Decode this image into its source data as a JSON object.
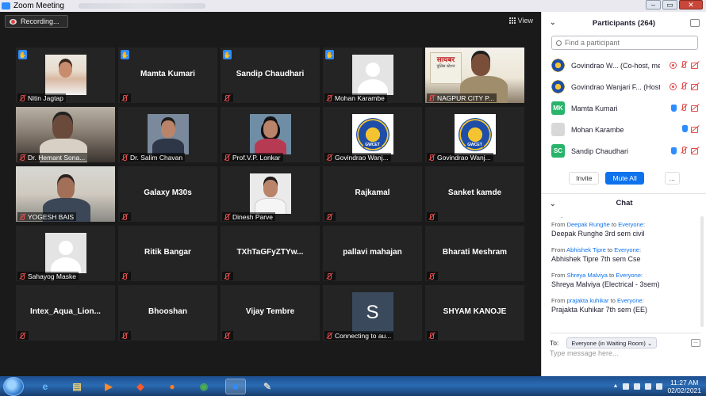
{
  "window": {
    "title": "Zoom Meeting"
  },
  "toolbar": {
    "recording_label": "Recording...",
    "view_label": "View"
  },
  "tiles": [
    {
      "name": "Nitin Jagtap",
      "kind": "child-photo",
      "hand": true
    },
    {
      "name": "Mamta Kumari",
      "kind": "name",
      "hand": true
    },
    {
      "name": "Sandip Chaudhari",
      "kind": "name",
      "hand": true
    },
    {
      "name": "Mohan Karambe",
      "kind": "avatar",
      "hand": true
    },
    {
      "name": "NAGPUR CITY P...",
      "kind": "video-nagpur",
      "active": true
    },
    {
      "name": "Dr. Hemant Sona...",
      "kind": "video-hemant"
    },
    {
      "name": "Dr. Salim Chavan",
      "kind": "portrait"
    },
    {
      "name": "Prof.V.P. Lonkar",
      "kind": "portrait-woman"
    },
    {
      "name": "Govindrao Wanj...",
      "kind": "logo"
    },
    {
      "name": "Govindrao Wanj...",
      "kind": "logo"
    },
    {
      "name": "YOGESH BAIS",
      "kind": "video-yogesh"
    },
    {
      "name": "Galaxy M30s",
      "kind": "name"
    },
    {
      "name": "Dinesh Parve",
      "kind": "portrait-light"
    },
    {
      "name": "Rajkamal",
      "kind": "name"
    },
    {
      "name": "Sanket kamde",
      "kind": "name"
    },
    {
      "name": "Sahayog Maske",
      "kind": "avatar"
    },
    {
      "name": "Ritik Bangar",
      "kind": "name"
    },
    {
      "name": "TXhTaGFyZTYw...",
      "kind": "name"
    },
    {
      "name": "pallavi mahajan",
      "kind": "name"
    },
    {
      "name": "Bharati Meshram",
      "kind": "name"
    },
    {
      "name": "Intex_Aqua_Lion...",
      "kind": "name"
    },
    {
      "name": "Bhooshan",
      "kind": "name"
    },
    {
      "name": "Vijay Tembre",
      "kind": "name"
    },
    {
      "name": "Connecting to au...",
      "kind": "letter",
      "letter": "S"
    },
    {
      "name": "SHYAM KANOJE",
      "kind": "name"
    }
  ],
  "nagpur_board": {
    "line1": "सायबर",
    "line2": "पुलिस स्टेशन"
  },
  "logo_text": "GWCET",
  "participants": {
    "title": "Participants (264)",
    "search_placeholder": "Find a participant",
    "rows": [
      {
        "name": "Govindrao W... (Co-host, me)",
        "avatar": "logo",
        "icons": [
          "rec-icon",
          "mic-muted-icon",
          "video-off-icon"
        ]
      },
      {
        "name": "Govindrao Wanjari F... (Host)",
        "avatar": "logo",
        "icons": [
          "rec-icon",
          "mic-muted-icon",
          "video-off-icon"
        ]
      },
      {
        "name": "Mamta Kumari",
        "avatar": "initials",
        "initials": "MK",
        "icons": [
          "raised-hand-icon",
          "mic-muted-icon",
          "video-off-icon"
        ]
      },
      {
        "name": "Mohan Karambe",
        "avatar": "gray",
        "icons": [
          "raised-hand-icon",
          "video-off-icon"
        ]
      },
      {
        "name": "Sandip Chaudhari",
        "avatar": "initials",
        "initials": "SC",
        "icons": [
          "raised-hand-icon",
          "mic-muted-icon",
          "video-off-icon"
        ]
      }
    ],
    "invite_label": "Invite",
    "mute_all_label": "Mute All",
    "more_label": "..."
  },
  "chat": {
    "title": "Chat",
    "messages": [
      {
        "from": "Deepak Runghe",
        "to": "Everyone",
        "text": "Deepak Runghe 3rd sem civil"
      },
      {
        "from": "Abhishek Tipre",
        "to": "Everyone",
        "text": "Abhishek Tipre 7th sem Cse"
      },
      {
        "from": "Shreya Malviya",
        "to": "Everyone",
        "text": "Shreya Malviya (Electrical - 3sem)"
      },
      {
        "from": "prajakta kuhikar",
        "to": "Everyone",
        "text": "Prajakta Kuhikar 7th sem (EE)"
      }
    ],
    "from_word": "From",
    "to_word": "to",
    "to_label": "To:",
    "recipient": "Everyone (in Waiting Room)",
    "input_placeholder": "Type message here..."
  },
  "taskbar": {
    "time": "11:27 AM",
    "date": "02/02/2021"
  },
  "colors": {
    "zoom_blue": "#0e72ed",
    "active_speaker": "#bcd36c",
    "muted_red": "#e04d4d"
  }
}
